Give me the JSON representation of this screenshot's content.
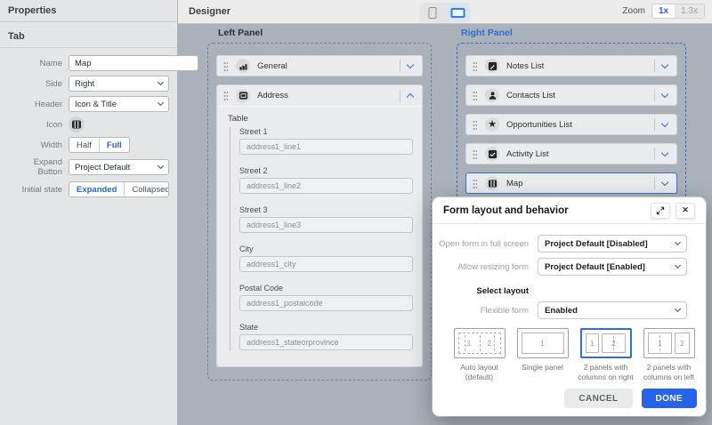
{
  "sidebar": {
    "title": "Properties",
    "section": "Tab",
    "fields": {
      "name": {
        "label": "Name",
        "value": "Map"
      },
      "side": {
        "label": "Side",
        "value": "Right"
      },
      "header": {
        "label": "Header",
        "value": "Icon & Title"
      },
      "icon": {
        "label": "Icon",
        "icon": "map-icon"
      },
      "width": {
        "label": "Width",
        "options": [
          "Half",
          "Full"
        ],
        "selected": "Full"
      },
      "expand_button": {
        "label": "Expand Button",
        "value": "Project Default"
      },
      "initial_state": {
        "label": "Initial state",
        "options": [
          "Expanded",
          "Collapsed"
        ],
        "selected": "Expanded"
      }
    }
  },
  "designer": {
    "title": "Designer",
    "device_toggle": {
      "options": [
        "phone",
        "tablet"
      ],
      "selected": "tablet"
    },
    "zoom": {
      "label": "Zoom",
      "options": [
        "1x",
        "1.3x"
      ],
      "selected": "1x"
    },
    "left_panel": {
      "label": "Left Panel",
      "items": [
        {
          "label": "General",
          "icon": "building-icon",
          "state": "collapsed"
        },
        {
          "label": "Address",
          "icon": "image-icon",
          "state": "expanded"
        }
      ],
      "address_section": {
        "group_label": "Table",
        "fields": [
          {
            "label": "Street 1",
            "value": "address1_line1"
          },
          {
            "label": "Street 2",
            "value": "address1_line2"
          },
          {
            "label": "Street 3",
            "value": "address1_line3"
          },
          {
            "label": "City",
            "value": "address1_city"
          },
          {
            "label": "Postal Code",
            "value": "address1_postalcode"
          },
          {
            "label": "State",
            "value": "address1_stateorprovince"
          }
        ]
      }
    },
    "right_panel": {
      "label": "Right Panel",
      "items": [
        {
          "label": "Notes List",
          "icon": "note-icon",
          "selected": false
        },
        {
          "label": "Contacts List",
          "icon": "person-icon",
          "selected": false
        },
        {
          "label": "Opportunities List",
          "icon": "star-icon",
          "selected": false
        },
        {
          "label": "Activity List",
          "icon": "checklist-icon",
          "selected": false
        },
        {
          "label": "Map",
          "icon": "map-icon",
          "selected": true
        }
      ]
    }
  },
  "dialog": {
    "title": "Form layout and behavior",
    "rows": [
      {
        "label": "Open form in full screen",
        "value": "Project Default [Disabled]"
      },
      {
        "label": "Allow resizing form",
        "value": "Project Default [Enabled]"
      }
    ],
    "select_layout_label": "Select layout",
    "flexible_form": {
      "label": "Flexible form",
      "value": "Enabled"
    },
    "layouts": [
      {
        "caption": "Auto layout (default)",
        "panels": [
          "1",
          "2"
        ],
        "selected": false
      },
      {
        "caption": "Single panel",
        "panels": [
          "1"
        ],
        "selected": false
      },
      {
        "caption": "2 panels with columns on right",
        "panels": [
          "1",
          "2"
        ],
        "selected": true
      },
      {
        "caption": "2 panels with columns on left",
        "panels": [
          "1",
          "2"
        ],
        "selected": false
      }
    ],
    "buttons": {
      "cancel": "CANCEL",
      "done": "DONE"
    }
  },
  "colors": {
    "accent_blue": "#2e6fd8",
    "done_button": "#2563e8",
    "canvas_background": "#aab1b8",
    "card_background": "#e9ebee",
    "sidebar_background": "#e4e5e6"
  }
}
